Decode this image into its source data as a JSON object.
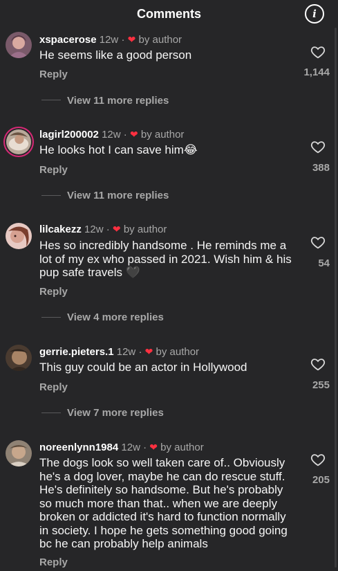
{
  "header": {
    "title": "Comments",
    "info_icon": "i"
  },
  "comments": [
    {
      "username": "xspacerose",
      "time": "12w",
      "separator": "·",
      "heart": "❤",
      "by_author": "by author",
      "text": "He seems like a good person",
      "reply": "Reply",
      "likes": "1,144",
      "view_replies": "View 11 more replies"
    },
    {
      "username": "lagirl200002",
      "time": "12w",
      "separator": "·",
      "heart": "❤",
      "by_author": "by author",
      "text": "He looks hot I can save him😂",
      "reply": "Reply",
      "likes": "388",
      "view_replies": "View 11 more replies"
    },
    {
      "username": "lilcakezz",
      "time": "12w",
      "separator": "·",
      "heart": "❤",
      "by_author": "by author",
      "text": "Hes so incredibly handsome . He reminds me a lot of my ex who passed in 2021. Wish him & his pup safe travels 🖤",
      "reply": "Reply",
      "likes": "54",
      "view_replies": "View 4 more replies"
    },
    {
      "username": "gerrie.pieters.1",
      "time": "12w",
      "separator": "·",
      "heart": "❤",
      "by_author": "by author",
      "text": "This guy could be an actor in Hollywood",
      "reply": "Reply",
      "likes": "255",
      "view_replies": "View 7 more replies"
    },
    {
      "username": "noreenlynn1984",
      "time": "12w",
      "separator": "·",
      "heart": "❤",
      "by_author": "by author",
      "text": "The dogs look so well taken care of.. Obviously he's a dog lover, maybe he can do rescue stuff. He's definitely so handsome. But he's probably so much more than that.. when we are deeply broken or addicted it's hard to function normally in society. I hope he gets something good going bc he can probably help animals",
      "reply": "Reply",
      "likes": "205"
    }
  ],
  "colors": {
    "background": "#262628",
    "text_primary": "#f5f5f5",
    "text_secondary": "#a8a8a8",
    "heart": "#ff3040",
    "story_ring": "#d62976"
  },
  "icons": {
    "like": "heart-outline-icon",
    "by_author": "heart-filled-icon",
    "info": "info-icon"
  }
}
